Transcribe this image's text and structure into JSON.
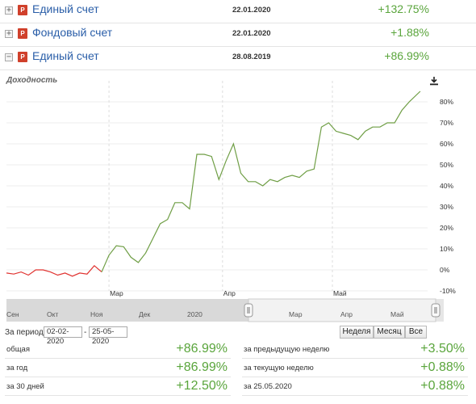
{
  "accounts": [
    {
      "expander": "+",
      "badge": "P",
      "name": "Единый счет",
      "date": "22.01.2020",
      "return": "+132.75%"
    },
    {
      "expander": "+",
      "badge": "P",
      "name": "Фондовый счет",
      "date": "22.01.2020",
      "return": "+1.88%"
    },
    {
      "expander": "−",
      "badge": "P",
      "name": "Единый счет",
      "date": "28.08.2019",
      "return": "+86.99%"
    }
  ],
  "chart": {
    "title": "Доходность",
    "download_icon": "download-icon"
  },
  "chart_data": {
    "type": "line",
    "title": "Доходность",
    "xlabel": "",
    "ylabel": "",
    "ylim": [
      -10,
      90
    ],
    "y_ticks": [
      "-10%",
      "0%",
      "10%",
      "20%",
      "30%",
      "40%",
      "50%",
      "60%",
      "70%",
      "80%"
    ],
    "x_ticks": [
      "Мар",
      "Апр",
      "Май"
    ],
    "grid": true,
    "series": [
      {
        "color_negative": "#e0322f",
        "color_positive": "#6f9e45",
        "x": [
          "2020-02-02",
          "2020-02-04",
          "2020-02-06",
          "2020-02-08",
          "2020-02-10",
          "2020-02-12",
          "2020-02-14",
          "2020-02-16",
          "2020-02-18",
          "2020-02-20",
          "2020-02-22",
          "2020-02-24",
          "2020-02-26",
          "2020-02-28",
          "2020-03-01",
          "2020-03-03",
          "2020-03-05",
          "2020-03-07",
          "2020-03-09",
          "2020-03-11",
          "2020-03-13",
          "2020-03-15",
          "2020-03-17",
          "2020-03-19",
          "2020-03-21",
          "2020-03-23",
          "2020-03-25",
          "2020-03-27",
          "2020-03-29",
          "2020-03-31",
          "2020-04-02",
          "2020-04-04",
          "2020-04-06",
          "2020-04-08",
          "2020-04-10",
          "2020-04-12",
          "2020-04-14",
          "2020-04-16",
          "2020-04-18",
          "2020-04-20",
          "2020-04-22",
          "2020-04-24",
          "2020-04-26",
          "2020-04-28",
          "2020-04-30",
          "2020-05-02",
          "2020-05-04",
          "2020-05-06",
          "2020-05-08",
          "2020-05-10",
          "2020-05-12",
          "2020-05-14",
          "2020-05-16",
          "2020-05-18",
          "2020-05-20",
          "2020-05-22",
          "2020-05-25"
        ],
        "values": [
          -1.5,
          -2,
          -1,
          -2.5,
          0,
          0,
          -1,
          -2.5,
          -1.5,
          -3,
          -1.5,
          -2,
          2,
          -1,
          7,
          11.5,
          11,
          6,
          3.5,
          8,
          15,
          22,
          24,
          32,
          32,
          29,
          55,
          55,
          54,
          43,
          52,
          60,
          46,
          42,
          42,
          40,
          43,
          42,
          44,
          45,
          44,
          47,
          48,
          68,
          70,
          66,
          65,
          64,
          62,
          66,
          68,
          68,
          70,
          70,
          76,
          80,
          85
        ]
      }
    ]
  },
  "navigator": {
    "labels": [
      "Сен",
      "Окт",
      "Ноя",
      "Дек",
      "2020",
      "Мар",
      "Апр",
      "Май"
    ]
  },
  "period": {
    "label": "За период",
    "from": "02-02-2020",
    "to": "25-05-2020",
    "separator": "-"
  },
  "range_buttons": [
    "Неделя",
    "Месяц",
    "Все"
  ],
  "stats_left": [
    {
      "label": "общая",
      "value": "+86.99%"
    },
    {
      "label": "за год",
      "value": "+86.99%"
    },
    {
      "label": "за 30 дней",
      "value": "+12.50%"
    }
  ],
  "stats_right": [
    {
      "label": "за предыдущую неделю",
      "value": "+3.50%"
    },
    {
      "label": "за текущую неделю",
      "value": "+0.88%"
    },
    {
      "label": "за 25.05.2020",
      "value": "+0.88%"
    }
  ]
}
